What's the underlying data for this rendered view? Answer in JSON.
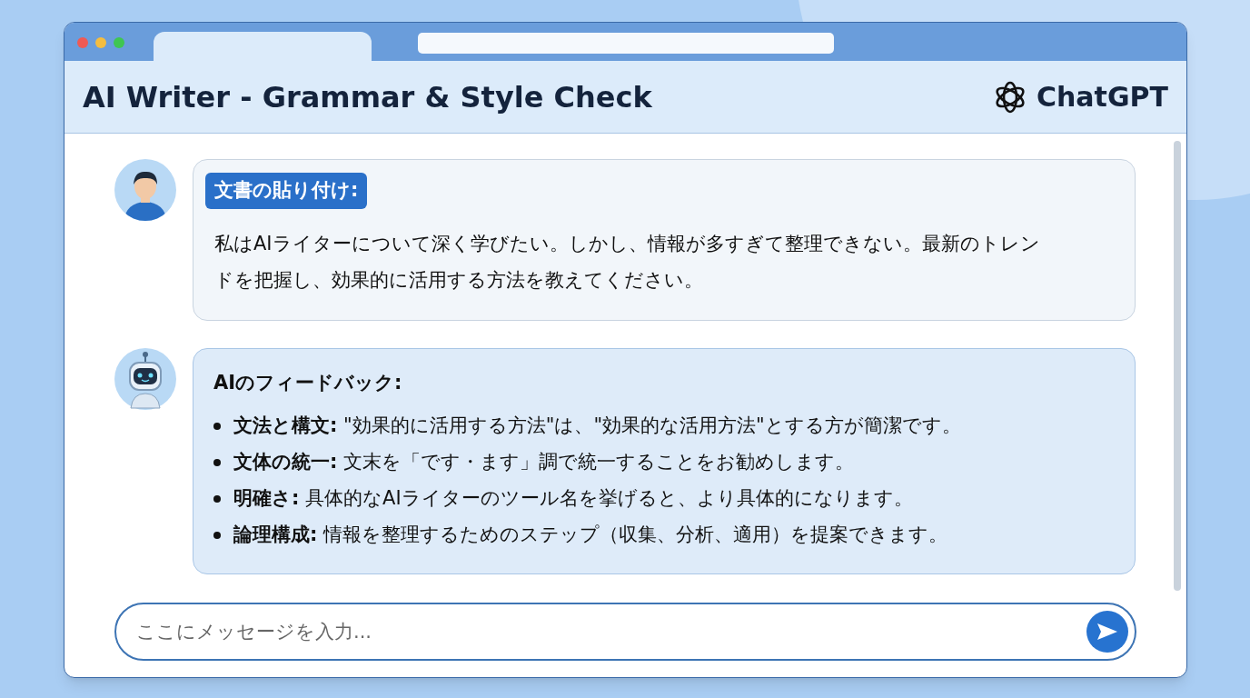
{
  "window": {
    "title": "AI Writer - Grammar & Style Check",
    "brand": "ChatGPT"
  },
  "messages": [
    {
      "kind": "user",
      "heading": "文書の貼り付け:",
      "body": "私はAIライターについて深く学びたい。しかし、情報が多すぎて整理できない。最新のトレンドを把握し、効果的に活用する方法を教えてください。"
    },
    {
      "kind": "assistant",
      "heading": "AIのフィードバック:",
      "items": [
        "**文法と構文:** \"効果的に活用する方法\"は、\"効果的な活用方法\"とする方が簡潔です。",
        "**文体の統一:** 文末を「です・ます」調で統一することをお勧めします。",
        "**明確さ:** 具体的なAIライターのツール名を挙げると、より具体的になります。",
        "**論理構成:** 情報を整理するためのステップ（収集、分析、適用）を提案できます。"
      ]
    }
  ],
  "input": {
    "placeholder": "ここにメッセージを入力..."
  }
}
